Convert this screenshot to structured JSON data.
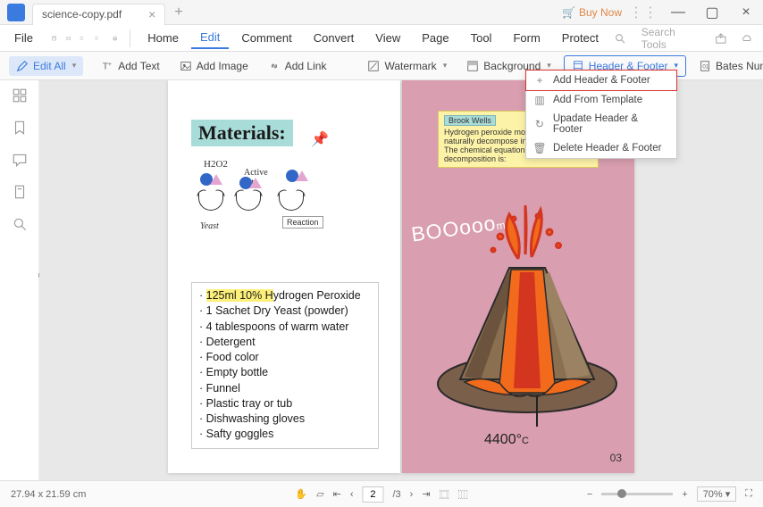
{
  "titlebar": {
    "filename": "science-copy.pdf",
    "buy_now": "Buy Now"
  },
  "menubar": {
    "file": "File",
    "items": [
      "Home",
      "Edit",
      "Comment",
      "Convert",
      "View",
      "Page",
      "Tool",
      "Form",
      "Protect"
    ],
    "active_index": 1,
    "search_placeholder": "Search Tools"
  },
  "toolbar": {
    "edit_all": "Edit All",
    "add_text": "Add Text",
    "add_image": "Add Image",
    "add_link": "Add Link",
    "watermark": "Watermark",
    "background": "Background",
    "header_footer": "Header & Footer",
    "bates_number": "Bates Number"
  },
  "dropdown": {
    "add_hf": "Add Header & Footer",
    "add_template": "Add From Template",
    "update_hf": "Upadate Header & Footer",
    "delete_hf": "Delete Header & Footer"
  },
  "doc": {
    "materials_title": "Materials:",
    "diagram": {
      "h2o2": "H2O2",
      "active_site": "Active Site",
      "yeast": "Yeast",
      "reaction": "Reaction"
    },
    "list": [
      "125ml 10% Hydrogen Peroxide",
      "1 Sachet Dry Yeast (powder)",
      "4 tablespoons of warm water",
      "Detergent",
      "Food color",
      "Empty bottle",
      "Funnel",
      "Plastic tray or tub",
      "Dishwashing gloves",
      "Safty goggles"
    ],
    "highlight_prefix": "125ml 10% H",
    "note": {
      "user": "Brook Wells",
      "line1": "Hydrogen peroxide molecules ar",
      "line2": "naturally decompose into water a",
      "line3": "The chemical equation for this decomposition is:"
    },
    "boom": "BOOooo",
    "boom_small": "m!",
    "temp": "4400°",
    "temp_c": "C",
    "page_num": "03"
  },
  "statusbar": {
    "dims": "27.94 x 21.59 cm",
    "page_current": "2",
    "page_total": "/3",
    "zoom": "70%"
  }
}
